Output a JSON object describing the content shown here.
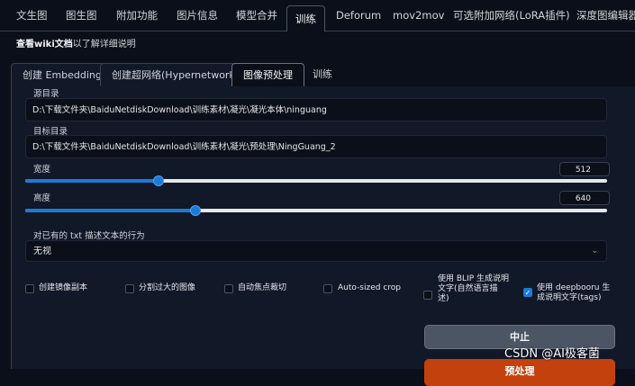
{
  "nav": {
    "tabs": [
      "文生图",
      "图生图",
      "附加功能",
      "图片信息",
      "模型合并",
      "训练",
      "Deforum",
      "mov2mov",
      "可选附加网络(LoRA插件)",
      "深度图编辑器"
    ]
  },
  "wiki": {
    "link": "查看wiki文档",
    "rest": "以了解详细说明"
  },
  "subtabs": [
    "创建 Embedding",
    "创建超网络(Hypernetwork)",
    "图像预处理",
    "训练"
  ],
  "form": {
    "source_label": "源目录",
    "source_value": "D:\\下载文件夹\\BaiduNetdiskDownload\\训练素材\\凝光\\凝光本体\\ninguang",
    "target_label": "目标目录",
    "target_value": "D:\\下载文件夹\\BaiduNetdiskDownload\\训练素材\\凝光\\预处理\\NingGuang_2",
    "width_label": "宽度",
    "width_value": "512",
    "height_label": "高度",
    "height_value": "640",
    "slider_fraction": {
      "width": 0.229,
      "height": 0.292
    },
    "txt_action_label": "对已有的 txt 描述文本的行为",
    "txt_action_value": "无视"
  },
  "options": [
    {
      "label": "创建镜像副本",
      "checked": false
    },
    {
      "label": "分割过大的图像",
      "checked": false
    },
    {
      "label": "自动焦点裁切",
      "checked": false
    },
    {
      "label": "Auto-sized crop",
      "checked": false
    },
    {
      "label_lines": [
        "使用 BLIP 生成说明",
        "文字(自然语言描",
        "述)"
      ],
      "checked": false
    },
    {
      "label_lines": [
        "使用 deepbooru 生",
        "成说明文字(tags)"
      ],
      "checked": true
    }
  ],
  "buttons": {
    "interrupt": "中止",
    "preprocess": "预处理"
  },
  "watermark": "CSDN @AI极客菌",
  "colors": {
    "background": "#0b0f19",
    "panel": "#111827",
    "accent": "#1d7bd8",
    "primary_button": "#c2410c"
  }
}
